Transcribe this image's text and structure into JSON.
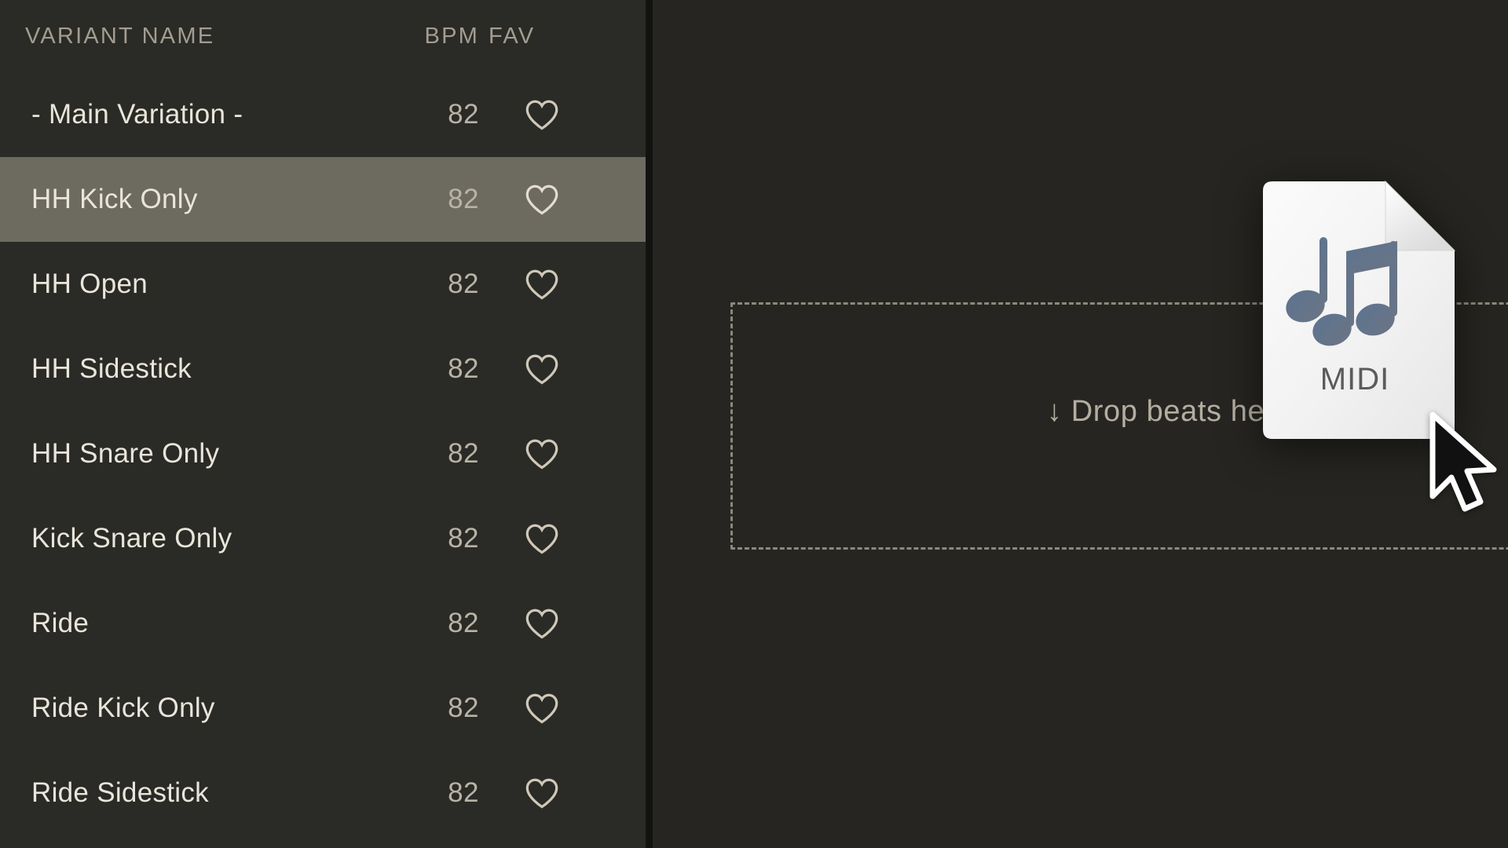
{
  "sidebar": {
    "table": {
      "columns": [
        {
          "key": "name",
          "label": "VARIANT NAME"
        },
        {
          "key": "bpm",
          "label": "BPM"
        },
        {
          "key": "fav",
          "label": "FAV"
        }
      ],
      "rows": [
        {
          "name": "- Main Variation -",
          "bpm": "82",
          "fav_icon": "heart-outline-icon",
          "favorited": false,
          "selected": false
        },
        {
          "name": "HH Kick Only",
          "bpm": "82",
          "fav_icon": "heart-outline-icon",
          "favorited": false,
          "selected": true
        },
        {
          "name": "HH Open",
          "bpm": "82",
          "fav_icon": "heart-outline-icon",
          "favorited": false,
          "selected": false
        },
        {
          "name": "HH Sidestick",
          "bpm": "82",
          "fav_icon": "heart-outline-icon",
          "favorited": false,
          "selected": false
        },
        {
          "name": "HH Snare Only",
          "bpm": "82",
          "fav_icon": "heart-outline-icon",
          "favorited": false,
          "selected": false
        },
        {
          "name": "Kick Snare Only",
          "bpm": "82",
          "fav_icon": "heart-outline-icon",
          "favorited": false,
          "selected": false
        },
        {
          "name": "Ride",
          "bpm": "82",
          "fav_icon": "heart-outline-icon",
          "favorited": false,
          "selected": false
        },
        {
          "name": "Ride Kick Only",
          "bpm": "82",
          "fav_icon": "heart-outline-icon",
          "favorited": false,
          "selected": false
        },
        {
          "name": "Ride Sidestick",
          "bpm": "82",
          "fav_icon": "heart-outline-icon",
          "favorited": false,
          "selected": false
        }
      ]
    }
  },
  "main": {
    "drop_zone": {
      "label": "↓ Drop beats here",
      "arrow_icon": "arrow-down-icon",
      "border_style": "dashed"
    }
  },
  "drag_ghost": {
    "file_type_label": "MIDI",
    "icon": "music-note-icon",
    "document_icon": "file-document-icon"
  },
  "cursor": {
    "icon": "mouse-pointer-icon"
  },
  "colors": {
    "sidebar_bg": "#2a2a26",
    "main_bg": "#262521",
    "row_selected_bg": "#6d6a5f",
    "divider": "#121211",
    "text_primary": "#e9e5da",
    "text_muted": "#b9b3a5",
    "header_text": "#a39d90",
    "dashed_border": "#8d887c",
    "ghost_card": "#f4f4f4",
    "note_accent": "#667388",
    "midi_label": "#5b5b5b"
  }
}
